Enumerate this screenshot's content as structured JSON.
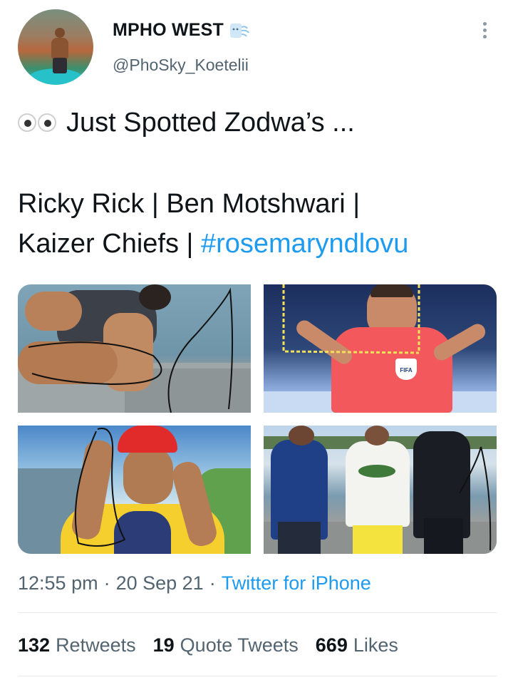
{
  "author": {
    "display_name": "MPHO WEST",
    "handle": "@PhoSky_Koetelii",
    "badge_icon": "wind-face-icon"
  },
  "tweet": {
    "emoji_icon": "eyes-icon",
    "line1": "Just Spotted Zodwa’s ...",
    "line2": "Ricky Rick | Ben Motshwari |",
    "line3_text": "Kaizer Chiefs | ",
    "hashtag": "#rosemaryndlovu"
  },
  "media": {
    "images": [
      {
        "name": "photo-person-leaning-over-water"
      },
      {
        "name": "photo-referee-fifa"
      },
      {
        "name": "photo-man-red-cap-yellow-shirt"
      },
      {
        "name": "photo-three-men-by-lake"
      }
    ],
    "referee_badge_text": "FIFA"
  },
  "meta": {
    "time": "12:55 pm",
    "date": "20 Sep 21",
    "source": "Twitter for iPhone",
    "sep": "·"
  },
  "stats": {
    "retweets_count": "132",
    "retweets_label": "Retweets",
    "quotes_count": "19",
    "quotes_label": "Quote Tweets",
    "likes_count": "669",
    "likes_label": "Likes"
  },
  "colors": {
    "link": "#1d9bf0",
    "secondary_text": "#536471",
    "primary_text": "#0f1419"
  }
}
